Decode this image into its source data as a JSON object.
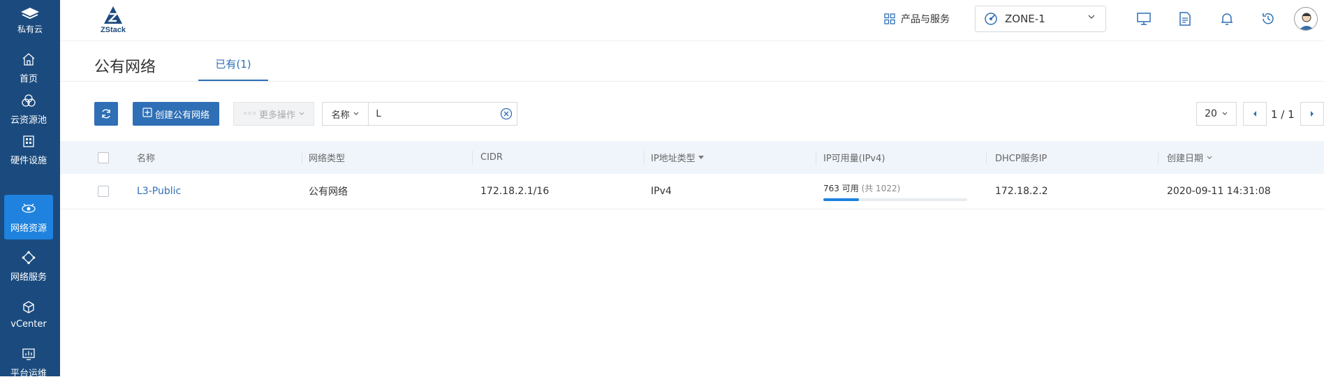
{
  "sidebar": {
    "brand_label": "私有云",
    "items": [
      {
        "label": "首页",
        "icon": "home-icon"
      },
      {
        "label": "云资源池",
        "icon": "cloud-pool-icon"
      },
      {
        "label": "硬件设施",
        "icon": "hardware-icon"
      },
      {
        "label": "网络资源",
        "icon": "network-resource-icon",
        "active": true
      },
      {
        "label": "网络服务",
        "icon": "network-service-icon"
      },
      {
        "label": "vCenter",
        "icon": "vcenter-icon"
      },
      {
        "label": "平台运维",
        "icon": "platform-ops-icon"
      }
    ]
  },
  "header": {
    "logo_text": "ZStack",
    "products_label": "产品与服务",
    "zone_label": "ZONE-1",
    "icons": [
      "monitor-icon",
      "document-icon",
      "bell-icon",
      "history-icon",
      "user-avatar-icon"
    ]
  },
  "page": {
    "title": "公有网络",
    "tab_label": "已有(1)"
  },
  "toolbar": {
    "create_label": "创建公有网络",
    "more_label": "更多操作",
    "search_field": "名称",
    "search_value": "L",
    "page_size": "20",
    "page_info": "1 / 1"
  },
  "table": {
    "columns": [
      "名称",
      "网络类型",
      "CIDR",
      "IP地址类型",
      "IP可用量(IPv4)",
      "DHCP服务IP",
      "创建日期"
    ],
    "rows": [
      {
        "name": "L3-Public",
        "network_type": "公有网络",
        "cidr": "172.18.2.1/16",
        "ip_type": "IPv4",
        "ip_available_text": "763 可用",
        "ip_total_text": "(共 1022)",
        "ip_available_fraction": 0.2466,
        "dhcp_ip": "172.18.2.2",
        "created": "2020-09-11 14:31:08"
      }
    ]
  },
  "colors": {
    "sidebar_bg": "#1b4b7e",
    "sidebar_active": "#1e82de",
    "primary": "#2f6fb5",
    "header_row_bg": "#f0f5fb"
  }
}
